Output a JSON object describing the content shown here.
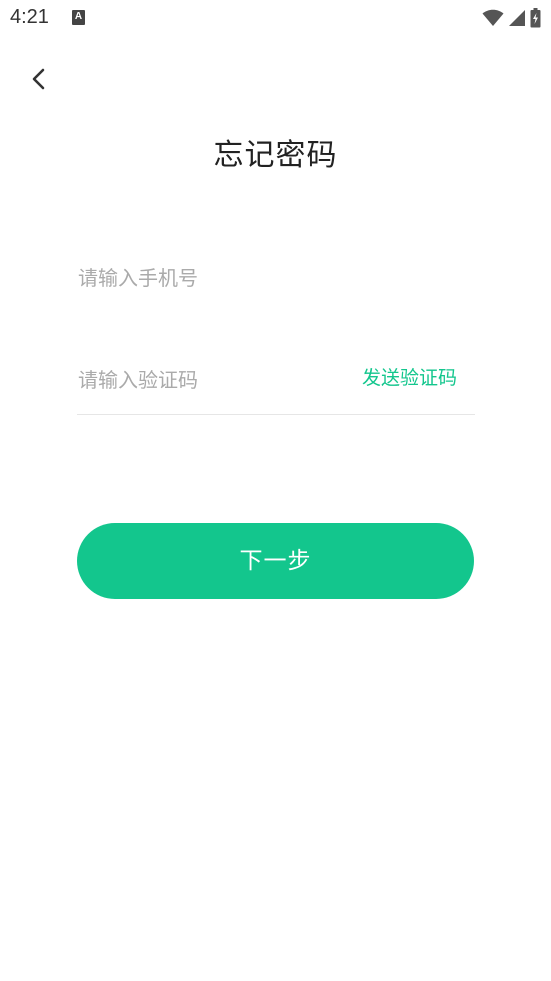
{
  "status_bar": {
    "time": "4:21",
    "notification_icon_letter": "A"
  },
  "header": {
    "back_icon": "chevron-left-icon",
    "title": "忘记密码"
  },
  "form": {
    "phone": {
      "value": "",
      "placeholder": "请输入手机号"
    },
    "code": {
      "value": "",
      "placeholder": "请输入验证码",
      "send_label": "发送验证码"
    },
    "next_label": "下一步"
  },
  "colors": {
    "accent": "#13c68d",
    "placeholder": "#aaaaaa",
    "title": "#222222",
    "divider": "#e6e6e6"
  }
}
